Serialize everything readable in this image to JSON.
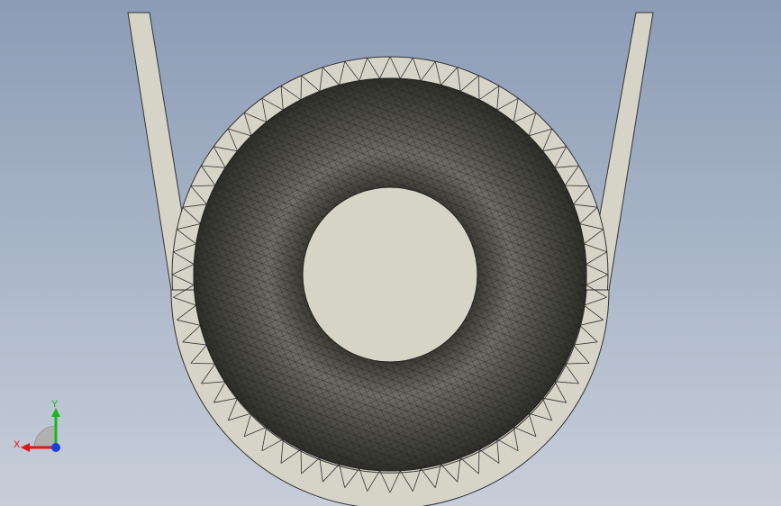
{
  "viewport": {
    "background_top": "#8b9cb5",
    "background_bottom": "#c7ced9"
  },
  "model": {
    "name": "sheet-metal-u-clamp-with-torus",
    "body_color": "#d6d4c7",
    "mesh_color": "#2a2a2a",
    "torus_color": "#5a5a52"
  },
  "triad": {
    "x_label": "X",
    "y_label": "Y",
    "x_color": "#e01515",
    "y_color": "#17b81f",
    "z_color": "#1b3de0",
    "x_icon": "x-axis-arrow-icon",
    "y_icon": "y-axis-arrow-icon",
    "z_icon": "z-axis-dot-icon"
  }
}
